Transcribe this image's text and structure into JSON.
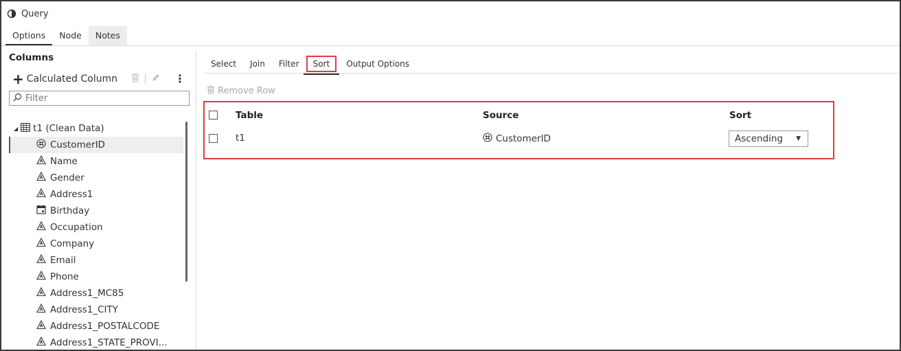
{
  "window": {
    "title": "Query"
  },
  "top_tabs": [
    {
      "label": "Options",
      "active": true
    },
    {
      "label": "Node",
      "active": false
    },
    {
      "label": "Notes",
      "active": false
    }
  ],
  "columns_panel": {
    "title": "Columns",
    "calculated_column_label": "Calculated Column",
    "filter_placeholder": "Filter",
    "tree_root": "t1 (Clean Data)",
    "items": [
      {
        "label": "CustomerID",
        "icon": "numeric-icon",
        "selected": true
      },
      {
        "label": "Name",
        "icon": "character-icon"
      },
      {
        "label": "Gender",
        "icon": "character-icon"
      },
      {
        "label": "Address1",
        "icon": "character-icon"
      },
      {
        "label": "Birthday",
        "icon": "calendar-icon"
      },
      {
        "label": "Occupation",
        "icon": "character-icon"
      },
      {
        "label": "Company",
        "icon": "character-icon"
      },
      {
        "label": "Email",
        "icon": "character-icon"
      },
      {
        "label": "Phone",
        "icon": "character-icon"
      },
      {
        "label": "Address1_MC85",
        "icon": "character-icon"
      },
      {
        "label": "Address1_CITY",
        "icon": "character-icon"
      },
      {
        "label": "Address1_POSTALCODE",
        "icon": "character-icon"
      },
      {
        "label": "Address1_STATE_PROVI...",
        "icon": "character-icon"
      }
    ]
  },
  "sub_tabs": [
    {
      "label": "Select",
      "active": false
    },
    {
      "label": "Join",
      "active": false
    },
    {
      "label": "Filter",
      "active": false
    },
    {
      "label": "Sort",
      "active": true
    },
    {
      "label": "Output Options",
      "active": false
    }
  ],
  "sort_panel": {
    "remove_row_label": "Remove Row",
    "headers": {
      "table": "Table",
      "source": "Source",
      "sort": "Sort"
    },
    "rows": [
      {
        "table": "t1",
        "source": "CustomerID",
        "sort": "Ascending"
      }
    ]
  },
  "colors": {
    "highlight": "#e03a3e",
    "text": "#333333",
    "disabled": "#a8a8a8"
  }
}
